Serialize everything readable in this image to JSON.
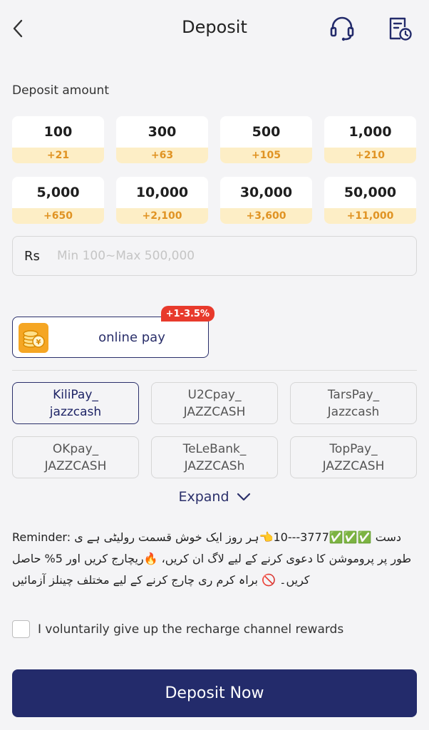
{
  "header": {
    "title": "Deposit",
    "back_icon": "chevron-left-icon",
    "support_icon": "headset-icon",
    "history_icon": "history-document-icon"
  },
  "deposit": {
    "label": "Deposit amount",
    "amounts": [
      {
        "amount": "100",
        "bonus": "+21"
      },
      {
        "amount": "300",
        "bonus": "+63"
      },
      {
        "amount": "500",
        "bonus": "+105"
      },
      {
        "amount": "1,000",
        "bonus": "+210"
      },
      {
        "amount": "5,000",
        "bonus": "+650"
      },
      {
        "amount": "10,000",
        "bonus": "+2,100"
      },
      {
        "amount": "30,000",
        "bonus": "+3,600"
      },
      {
        "amount": "50,000",
        "bonus": "+11,000"
      }
    ],
    "input": {
      "currency": "Rs",
      "placeholder": "Min 100~Max 500,000",
      "value": ""
    }
  },
  "payment_method": {
    "label": "online pay",
    "badge": "+1-3.5%",
    "icon": "coin-stack-icon",
    "accent": "#2a2f6a"
  },
  "channels": [
    {
      "label": "KiliPay_\njazzcash",
      "selected": true
    },
    {
      "label": "U2Cpay_\nJAZZCASH",
      "selected": false
    },
    {
      "label": "TarsPay_\nJazzcash",
      "selected": false
    },
    {
      "label": "OKpay_\nJAZZCASH",
      "selected": false
    },
    {
      "label": "TeLeBank_\nJAZZCASh",
      "selected": false
    },
    {
      "label": "TopPay_\nJAZZCASH",
      "selected": false
    }
  ],
  "expand": {
    "label": "Expand",
    "icon": "chevron-down-icon"
  },
  "reminder": {
    "text": "Reminder: دست ✅✅✅3777---10👈ہر روز ایک خوش قسمت رولیٹی ہے ی طور پر پروموشن کا دعوی کرنے کے لیے لاگ ان کریں، 🔥ریچارج کریں اور 5% حاصل کریں۔ 🚫 براہ کرم ری چارج کرنے کے لیے مختلف چینلز آزمائیں"
  },
  "consent": {
    "label": "I voluntarily give up the recharge channel rewards",
    "checked": false
  },
  "submit": {
    "label": "Deposit Now",
    "color": "#232b6b"
  }
}
